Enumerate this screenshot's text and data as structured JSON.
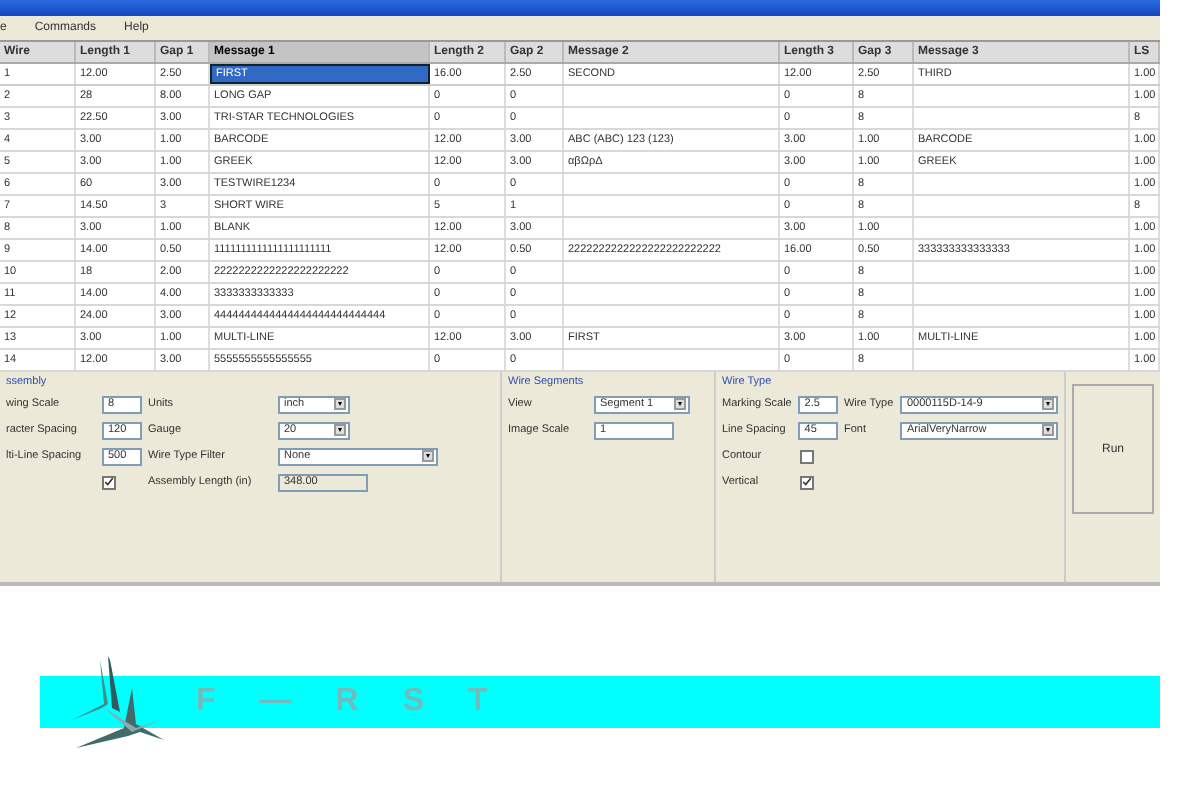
{
  "menu": [
    "e",
    "Commands",
    "Help"
  ],
  "table": {
    "columns": [
      {
        "label": "Wire",
        "selected": false
      },
      {
        "label": "Length 1",
        "selected": false
      },
      {
        "label": "Gap 1",
        "selected": false
      },
      {
        "label": "Message 1",
        "selected": true
      },
      {
        "label": "Length 2",
        "selected": false
      },
      {
        "label": "Gap 2",
        "selected": false
      },
      {
        "label": "Message 2",
        "selected": false
      },
      {
        "label": "Length 3",
        "selected": false
      },
      {
        "label": "Gap 3",
        "selected": false
      },
      {
        "label": "Message 3",
        "selected": false
      },
      {
        "label": "LS",
        "selected": false
      }
    ],
    "rows": [
      {
        "selected": true,
        "cells": [
          "1",
          "12.00",
          "2.50",
          "FIRST",
          "16.00",
          "2.50",
          "SECOND",
          "12.00",
          "2.50",
          "THIRD",
          "1.00"
        ]
      },
      {
        "selected": false,
        "cells": [
          "2",
          "28",
          "8.00",
          "LONG GAP",
          "0",
          "0",
          null,
          "0",
          "8",
          null,
          "1.00"
        ]
      },
      {
        "selected": false,
        "cells": [
          "3",
          "22.50",
          "3.00",
          "TRI-STAR TECHNOLOGIES",
          "0",
          "0",
          null,
          "0",
          "8",
          null,
          "8"
        ]
      },
      {
        "selected": false,
        "cells": [
          "4",
          "3.00",
          "1.00",
          "BARCODE",
          "12.00",
          "3.00",
          "ABC (ABC) 123 (123)",
          "3.00",
          "1.00",
          "BARCODE",
          "1.00"
        ]
      },
      {
        "selected": false,
        "cells": [
          "5",
          "3.00",
          "1.00",
          "GREEK",
          "12.00",
          "3.00",
          "αβΩρΔ",
          "3.00",
          "1.00",
          "GREEK",
          "1.00"
        ]
      },
      {
        "selected": false,
        "cells": [
          "6",
          "60",
          "3.00",
          "TESTWIRE1234",
          "0",
          "0",
          null,
          "0",
          "8",
          null,
          "1.00"
        ]
      },
      {
        "selected": false,
        "cells": [
          "7",
          "14.50",
          "3",
          "SHORT WIRE",
          "5",
          "1",
          null,
          "0",
          "8",
          null,
          "8"
        ]
      },
      {
        "selected": false,
        "cells": [
          "8",
          "3.00",
          "1.00",
          "BLANK",
          "12.00",
          "3.00",
          null,
          "3.00",
          "1.00",
          null,
          "1.00"
        ]
      },
      {
        "selected": false,
        "cells": [
          "9",
          "14.00",
          "0.50",
          "1111111111111111111111",
          "12.00",
          "0.50",
          "2222222222222222222222222",
          "16.00",
          "0.50",
          "333333333333333",
          "1.00"
        ]
      },
      {
        "selected": false,
        "cells": [
          "10",
          "18",
          "2.00",
          "2222222222222222222222",
          "0",
          "0",
          null,
          "0",
          "8",
          null,
          "1.00"
        ]
      },
      {
        "selected": false,
        "cells": [
          "11",
          "14.00",
          "4.00",
          "3333333333333",
          "0",
          "0",
          null,
          "0",
          "8",
          null,
          "1.00"
        ]
      },
      {
        "selected": false,
        "cells": [
          "12",
          "24.00",
          "3.00",
          "4444444444444444444444444444",
          "0",
          "0",
          null,
          "0",
          "8",
          null,
          "1.00"
        ]
      },
      {
        "selected": false,
        "cells": [
          "13",
          "3.00",
          "1.00",
          "MULTI-LINE",
          "12.00",
          "3.00",
          "FIRST",
          "3.00",
          "1.00",
          "MULTI-LINE",
          "1.00"
        ]
      },
      {
        "selected": false,
        "cells": [
          "14",
          "12.00",
          "3.00",
          "5555555555555555",
          "0",
          "0",
          null,
          "0",
          "8",
          null,
          "1.00"
        ]
      }
    ]
  },
  "assembly": {
    "title": "ssembly",
    "fields": [
      {
        "label": "wing Scale",
        "value": "8",
        "label2": "Units",
        "value2": "inch",
        "kind": "dropdown"
      },
      {
        "label": "racter Spacing",
        "value": "120",
        "label2": "Gauge",
        "value2": "20",
        "kind": "dropdown"
      },
      {
        "label": "lti-Line Spacing",
        "value": "500",
        "label2": "Wire Type Filter",
        "value2": "None",
        "kind": "wide-dropdown"
      }
    ],
    "checkbox": {
      "checked": true
    },
    "length_label": "Assembly Length (in)",
    "length_value": "348.00"
  },
  "wire_segments": {
    "title": "Wire Segments",
    "view_label": "View",
    "view_value": "Segment 1",
    "scale_label": "Image Scale",
    "scale_value": "1"
  },
  "wire_type": {
    "title": "Wire Type",
    "marking_scale_label": "Marking Scale",
    "marking_scale": "2.5",
    "wire_type_label": "Wire Type",
    "wire_type": "0000115D-14-9",
    "line_spacing_label": "Line Spacing",
    "line_spacing": "45",
    "font_label": "Font",
    "font": "ArialVeryNarrow",
    "options": [
      {
        "label": "Contour",
        "checked": false
      },
      {
        "label": "Vertical",
        "checked": true
      }
    ]
  },
  "run_button": "Run",
  "preview": {
    "letters": [
      "F",
      "—",
      "R",
      "S",
      "T"
    ]
  }
}
